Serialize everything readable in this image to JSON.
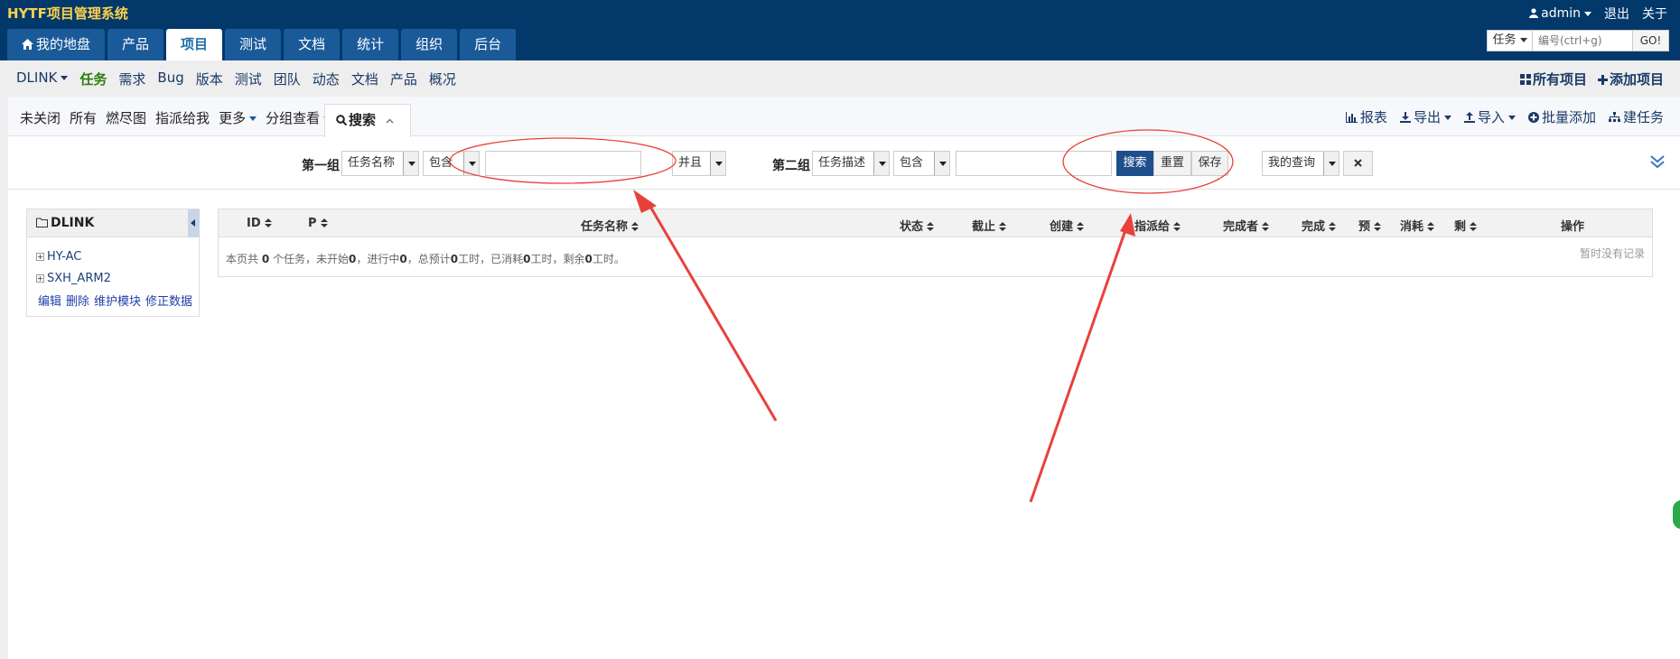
{
  "header": {
    "brand": "HYTF项目管理系统",
    "user": "admin",
    "logout": "退出",
    "about": "关于"
  },
  "main_nav": [
    {
      "label": "我的地盘",
      "active": false
    },
    {
      "label": "产品",
      "active": false
    },
    {
      "label": "项目",
      "active": true
    },
    {
      "label": "测试",
      "active": false
    },
    {
      "label": "文档",
      "active": false
    },
    {
      "label": "统计",
      "active": false
    },
    {
      "label": "组织",
      "active": false
    },
    {
      "label": "后台",
      "active": false
    }
  ],
  "top_search": {
    "type": "任务",
    "placeholder": "编号(ctrl+g)",
    "go": "GO!"
  },
  "sub_nav": {
    "project": "DLINK",
    "items": [
      "任务",
      "需求",
      "Bug",
      "版本",
      "测试",
      "团队",
      "动态",
      "文档",
      "产品",
      "概况"
    ],
    "all_projects": "所有项目",
    "add_project": "添加项目"
  },
  "feature_bar": {
    "items": [
      "未关闭",
      "所有",
      "燃尽图",
      "指派给我",
      "更多",
      "分组查看"
    ],
    "search_tab": "搜索",
    "actions": [
      "报表",
      "导出",
      "导入",
      "批量添加",
      "建任务"
    ]
  },
  "search_form": {
    "group1_label": "第一组",
    "group1_field": "任务名称",
    "group1_operator": "包含",
    "group1_value": "",
    "logic": "并且",
    "group2_label": "第二组",
    "group2_field": "任务描述",
    "group2_operator": "包含",
    "group2_value": "",
    "search_btn": "搜索",
    "reset_btn": "重置",
    "save_btn": "保存",
    "my_query": "我的查询"
  },
  "tree": {
    "root": "DLINK",
    "items": [
      "HY-AC",
      "SXH_ARM2"
    ],
    "actions": [
      "编辑",
      "删除",
      "维护模块",
      "修正数据"
    ]
  },
  "table": {
    "columns": [
      "ID",
      "P",
      "任务名称",
      "状态",
      "截止",
      "创建",
      "指派给",
      "完成者",
      "完成",
      "预",
      "消耗",
      "剩",
      "操作"
    ],
    "summary_parts": [
      "本页共",
      "0",
      "个任务，未开始",
      "0",
      "，进行中",
      "0",
      "，总预计",
      "0",
      "工时，已消耗",
      "0",
      "工时，剩余",
      "0",
      "工时。"
    ],
    "empty": "暂时没有记录"
  },
  "colors": {
    "header_bg": "#03386b",
    "brand": "#ffd24d",
    "tab_bg": "#1a5a99",
    "active_green": "#2e7d12",
    "annotation_red": "#e8413b"
  }
}
